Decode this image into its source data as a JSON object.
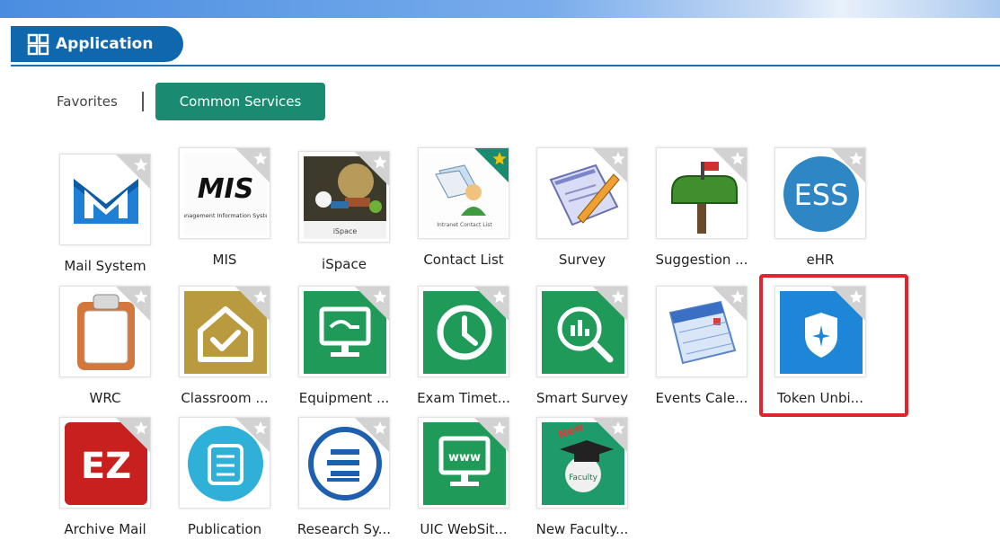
{
  "header": {
    "title": "Application",
    "icon": "grid-icon"
  },
  "tabs": [
    {
      "label": "Favorites",
      "active": false
    },
    {
      "label": "Common Services",
      "active": true
    }
  ],
  "apps": [
    {
      "id": "mail-system",
      "label": "Mail System",
      "icon": "envelope-m-icon",
      "favorite": false
    },
    {
      "id": "mis",
      "label": "MIS",
      "icon": "mis-logo-icon",
      "favorite": false,
      "icon_text": "MIS",
      "icon_subtext": "Management Information System"
    },
    {
      "id": "ispace",
      "label": "iSpace",
      "icon": "globe-books-icon",
      "favorite": false,
      "icon_text": "iSpace"
    },
    {
      "id": "contact-list",
      "label": "Contact List",
      "icon": "contact-book-icon",
      "favorite": true,
      "icon_text": "Intranet Contact List"
    },
    {
      "id": "survey",
      "label": "Survey",
      "icon": "clipboard-pencil-icon",
      "favorite": false
    },
    {
      "id": "suggestion",
      "label": "Suggestion ...",
      "icon": "mailbox-icon",
      "favorite": false
    },
    {
      "id": "ehr",
      "label": "eHR",
      "icon": "ess-logo-icon",
      "favorite": false,
      "icon_text": "ESS"
    },
    {
      "id": "wrc",
      "label": "WRC",
      "icon": "clipboard-icon",
      "favorite": false
    },
    {
      "id": "classroom",
      "label": "Classroom ...",
      "icon": "house-check-icon",
      "favorite": false
    },
    {
      "id": "equipment",
      "label": "Equipment ...",
      "icon": "monitor-icon",
      "favorite": false
    },
    {
      "id": "exam-timetable",
      "label": "Exam Timet...",
      "icon": "clock-icon",
      "favorite": false
    },
    {
      "id": "smart-survey",
      "label": "Smart Survey",
      "icon": "magnifier-chart-icon",
      "favorite": false
    },
    {
      "id": "events-calendar",
      "label": "Events Cale...",
      "icon": "calendar-icon",
      "favorite": false
    },
    {
      "id": "token-unbind",
      "label": "Token Unbi...",
      "icon": "shield-icon",
      "favorite": false
    },
    {
      "id": "archive-mail",
      "label": "Archive Mail",
      "icon": "ez-logo-icon",
      "favorite": false,
      "icon_text": "EZ"
    },
    {
      "id": "publication",
      "label": "Publication",
      "icon": "book-icon",
      "favorite": false
    },
    {
      "id": "research-system",
      "label": "Research Sy...",
      "icon": "research-logo-icon",
      "favorite": false
    },
    {
      "id": "uic-website",
      "label": "UIC WebSit...",
      "icon": "www-monitor-icon",
      "favorite": false,
      "icon_text": "www"
    },
    {
      "id": "new-faculty",
      "label": "New Faculty...",
      "icon": "graduation-cap-icon",
      "favorite": false,
      "icon_text": "New",
      "icon_subtext": "Faculty"
    }
  ],
  "colors": {
    "brand_blue": "#0f67ad",
    "tab_green": "#1a8a70",
    "favorite_green": "#1a8a70",
    "favorite_star": "#f2c200",
    "highlight_red": "#e0242a"
  }
}
